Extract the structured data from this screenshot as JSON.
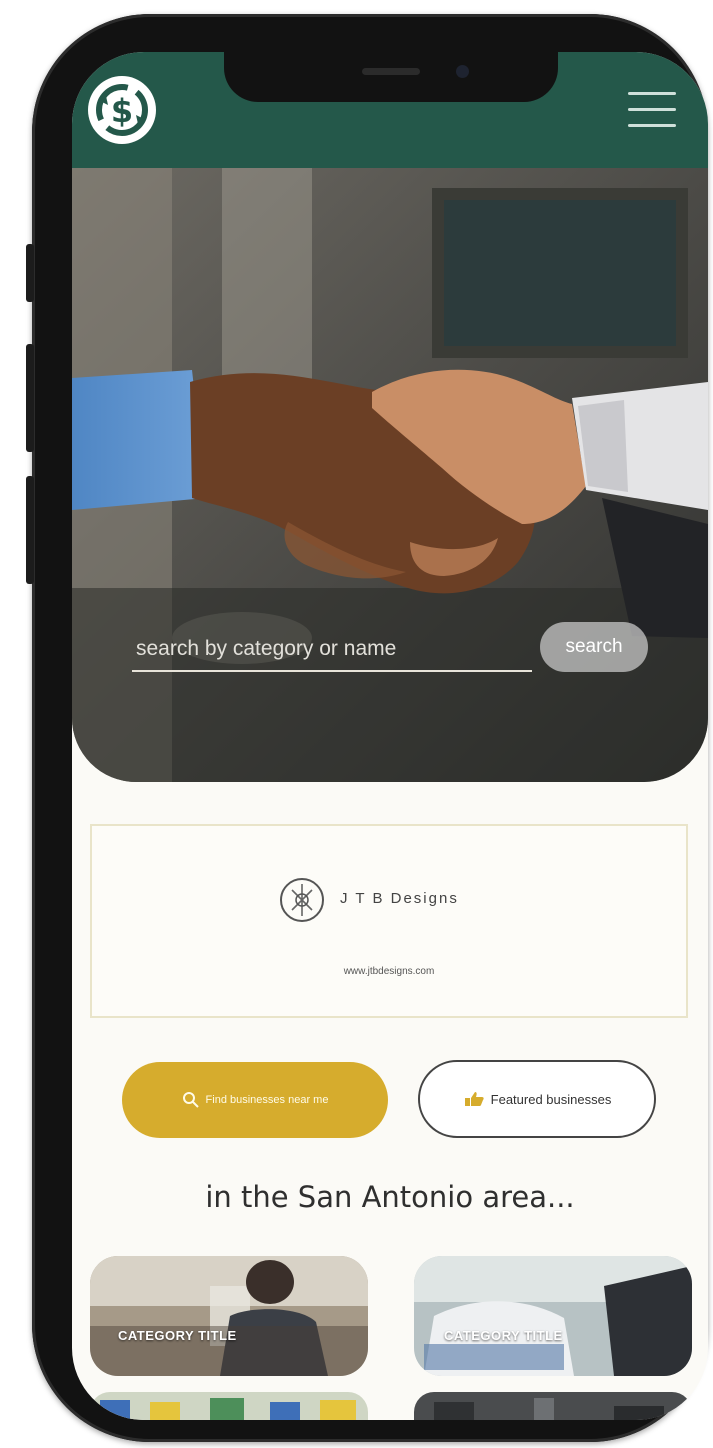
{
  "header": {
    "logo_icon": "dollar-sign-recycle-icon",
    "menu_icon": "hamburger-menu-icon"
  },
  "hero": {
    "search_placeholder": "search by category or name",
    "search_button_label": "search"
  },
  "ad": {
    "name": "J T B Designs",
    "url": "www.jtbdesigns.com"
  },
  "actions": {
    "find_label": "Find businesses near me",
    "featured_label": "Featured businesses"
  },
  "section": {
    "title": "in the San Antonio area..."
  },
  "categories": [
    {
      "label": "CATEGORY TITLE"
    },
    {
      "label": "CATEGORY TITLE"
    }
  ],
  "colors": {
    "header": "#24584a",
    "accent_gold": "#d6ac2d",
    "background": "#fbfaf6"
  }
}
